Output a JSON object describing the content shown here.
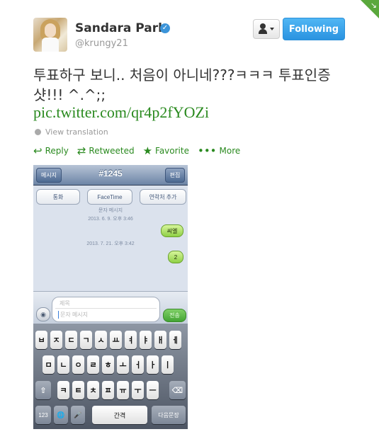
{
  "profile": {
    "name": "Sandara Park",
    "handle": "@krungy21",
    "verified_mark": "✓",
    "avatar": "user-avatar"
  },
  "header": {
    "follow_label": "Following",
    "user_actions_icon": "user-dropdown-icon",
    "corner_icon": "corner-arrow-icon"
  },
  "tweet": {
    "text": "투표하구 보니.. 처음이 아니네???ㅋㅋㅋ 투표인증샷!!! ^.^;;",
    "link": "pic.twitter.com/qr4p2fYOZi",
    "translate": "View translation"
  },
  "actions": [
    {
      "icon": "reply-icon",
      "glyph": "↩",
      "label": "Reply"
    },
    {
      "icon": "retweet-icon",
      "glyph": "⇄",
      "label": "Retweeted"
    },
    {
      "icon": "star-icon",
      "glyph": "★",
      "label": "Favorite"
    },
    {
      "icon": "more-icon",
      "glyph": "•••",
      "label": "More"
    }
  ],
  "phone": {
    "nav": {
      "back": "메시지",
      "title": "#1245",
      "edit": "편집"
    },
    "pills": [
      "통화",
      "FaceTime",
      "연락처 추가"
    ],
    "meta_label": "문자 메시지",
    "ts1": "2013. 6. 9. 오후 3:46",
    "msg1": "씨엘",
    "ts2": "2013. 7. 21. 오후 3:42",
    "msg2": "2",
    "compose": {
      "subject": "제목",
      "body": "문자 메시지",
      "send": "전송",
      "camera_icon": "camera-icon"
    },
    "keyboard": {
      "row1": [
        "ㅂ",
        "ㅈ",
        "ㄷ",
        "ㄱ",
        "ㅅ",
        "ㅛ",
        "ㅕ",
        "ㅑ",
        "ㅐ",
        "ㅔ"
      ],
      "row2": [
        "ㅁ",
        "ㄴ",
        "ㅇ",
        "ㄹ",
        "ㅎ",
        "ㅗ",
        "ㅓ",
        "ㅏ",
        "ㅣ"
      ],
      "row3": [
        "ㅋ",
        "ㅌ",
        "ㅊ",
        "ㅍ",
        "ㅠ",
        "ㅜ",
        "ㅡ"
      ],
      "shift": "⇧",
      "delete": "⌫",
      "num": "123",
      "globe": "🌐",
      "mic": "🎤",
      "space": "간격",
      "return": "다음문장"
    }
  }
}
